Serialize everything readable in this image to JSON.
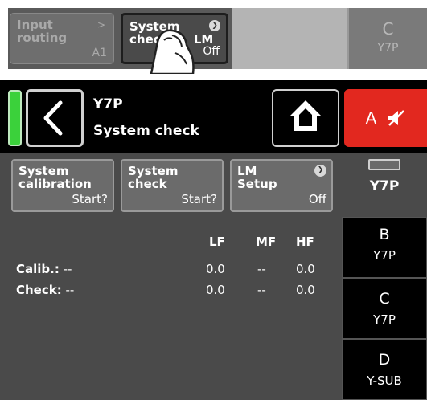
{
  "strip": {
    "btn_left": {
      "line1": "Input",
      "line2": "routing",
      "arrow": ">",
      "value": "A1"
    },
    "btn_active": {
      "line1": "System",
      "line2": "check",
      "overlap": "LM",
      "value": "Off"
    },
    "col": {
      "letter": "C",
      "model": "Y7P"
    }
  },
  "header": {
    "device_name": "Y7P",
    "page_title": "System check",
    "mute_label": "A"
  },
  "buttons": {
    "calibration": {
      "line1": "System",
      "line2": "calibration",
      "value": "Start?"
    },
    "check": {
      "line1": "System",
      "line2": "check",
      "value": "Start?"
    },
    "lm": {
      "line1": "LM",
      "line2": "Setup",
      "value": "Off"
    }
  },
  "table": {
    "headers": [
      "LF",
      "MF",
      "HF"
    ],
    "rows": [
      {
        "label": "Calib.:",
        "extra": "--",
        "values": [
          "0.0",
          "--",
          "0.0"
        ]
      },
      {
        "label": "Check:",
        "extra": "--",
        "values": [
          "0.0",
          "--",
          "0.0"
        ]
      }
    ]
  },
  "tabs": [
    {
      "letter": "",
      "model": "Y7P"
    },
    {
      "letter": "B",
      "model": "Y7P"
    },
    {
      "letter": "C",
      "model": "Y7P"
    },
    {
      "letter": "D",
      "model": "Y-SUB"
    }
  ],
  "colors": {
    "power": "#3bd13b",
    "mute": "#e2281f",
    "panel": "#4a4a4a"
  }
}
